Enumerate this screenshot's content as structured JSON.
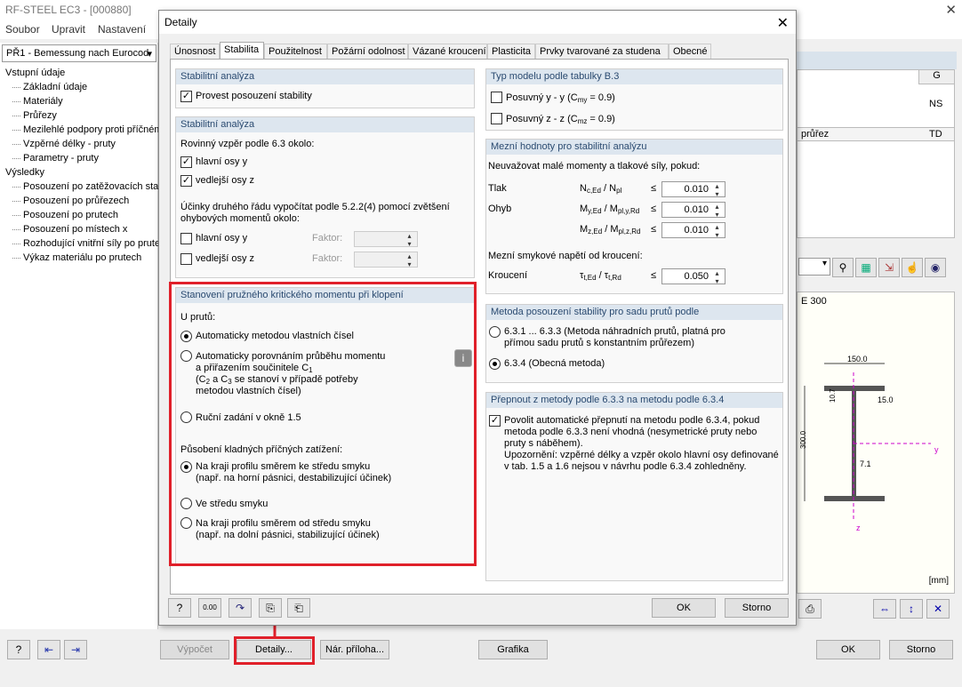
{
  "main_window": {
    "title": "RF-STEEL EC3 - [000880]",
    "menu": [
      "Soubor",
      "Upravit",
      "Nastavení"
    ]
  },
  "left_panel": {
    "case_select": "PŘ1 - Bemessung nach Eurocod",
    "tree": [
      {
        "label": "Vstupní údaje",
        "level": 0
      },
      {
        "label": "Základní údaje",
        "level": 1
      },
      {
        "label": "Materiály",
        "level": 1
      },
      {
        "label": "Průřezy",
        "level": 1
      },
      {
        "label": "Mezilehlé podpory proti příčném",
        "level": 1
      },
      {
        "label": "Vzpěrné délky - pruty",
        "level": 1
      },
      {
        "label": "Parametry - pruty",
        "level": 1
      },
      {
        "label": "Výsledky",
        "level": 0
      },
      {
        "label": "Posouzení po zatěžovacích stav",
        "level": 1
      },
      {
        "label": "Posouzení po průřezech",
        "level": 1
      },
      {
        "label": "Posouzení po prutech",
        "level": 1
      },
      {
        "label": "Posouzení po místech x",
        "level": 1
      },
      {
        "label": "Rozhodující vnitřní síly po prute",
        "level": 1
      },
      {
        "label": "Výkaz materiálu po prutech",
        "level": 1
      }
    ]
  },
  "bottom_bar": {
    "calc": "Výpočet",
    "details": "Detaily...",
    "annex": "Nár. příloha...",
    "graphics": "Grafika",
    "ok": "OK",
    "cancel": "Storno"
  },
  "right_panel": {
    "col_g": "G",
    "ns": "NS",
    "prurez": "průřez",
    "td": "TD",
    "section_label": "E 300",
    "dims": {
      "flange_w": "150.0",
      "flange_t": "10.7",
      "web_label": "15.0",
      "height": "300.0",
      "web_t": "7.1",
      "y": "y",
      "z": "z"
    },
    "unit": "[mm]"
  },
  "dialog": {
    "title": "Detaily",
    "tabs": [
      "Únosnost",
      "Stabilita",
      "Použitelnost",
      "Požární odolnost",
      "Vázané kroucení",
      "Plasticita",
      "Prvky tvarované za studena",
      "Obecné"
    ],
    "active_tab": "Stabilita",
    "g1": {
      "head": "Stabilitní analýza",
      "check": "Provest posouzení stability"
    },
    "g2": {
      "head": "Stabilitní analýza",
      "planar": "Rovinný vzpěr podle 6.3 okolo:",
      "main_axis": "hlavní osy y",
      "minor_axis": "vedlejší osy z",
      "second_order": "Účinky druhého řádu vypočítat podle 5.2.2(4) pomocí zvětšení",
      "second_order2": "ohybových momentů okolo:",
      "main_axis2": "hlavní osy y",
      "minor_axis2": "vedlejší osy z",
      "factor": "Faktor:"
    },
    "g3": {
      "head": "Stanovení pružného kritického momentu při klopení",
      "members": "U prutů:",
      "opt1": "Automaticky metodou vlastních čísel",
      "opt2a": "Automaticky porovnáním průběhu momentu",
      "opt2b": "a přiřazením součinitele C",
      "opt2c": "(C",
      "opt2c2": " a C",
      "opt2c3": " se stanoví v případě potřeby",
      "opt2d": "metodou vlastních čísel)",
      "opt3": "Ruční zadání v okně 1.5",
      "loads": "Působení kladných příčných zatížení:",
      "load1a": "Na kraji profilu směrem ke středu smyku",
      "load1b": "(např. na horní pásnici, destabilizující účinek)",
      "load2": "Ve středu smyku",
      "load3a": "Na kraji profilu směrem od středu smyku",
      "load3b": "(např. na dolní pásnici, stabilizující účinek)",
      "sub1": "1",
      "sub2": "2",
      "sub3": "3"
    },
    "g4": {
      "head": "Typ modelu podle tabulky B.3",
      "yy": "Posuvný y - y (C",
      "yy_sub": "my",
      "yy_end": " = 0.9)",
      "zz": "Posuvný z - z (C",
      "zz_sub": "mz",
      "zz_end": " = 0.9)"
    },
    "g5": {
      "head": "Mezní hodnoty pro stabilitní analýzu",
      "neglect": "Neuvažovat malé momenty a tlakové síly, pokud:",
      "tlak": "Tlak",
      "ohyb": "Ohyb",
      "ratio_n": "N",
      "ratio_n_sub": "c,Ed",
      "ratio_n2": " / N",
      "ratio_n2_sub": "pl",
      "ratio_my": "M",
      "ratio_my_sub": "y,Ed",
      "ratio_my2": " / M",
      "ratio_my2_sub": "pl,y,Rd",
      "ratio_mz": "M",
      "ratio_mz_sub": "z,Ed",
      "ratio_mz2": " / M",
      "ratio_mz2_sub": "pl,z,Rd",
      "le": "≤",
      "v_n": "0.010",
      "v_my": "0.010",
      "v_mz": "0.010",
      "shear": "Mezní smykové napětí od kroucení:",
      "kroucen": "Kroucení",
      "tau": "τ",
      "tau_sub": "t,Ed",
      "tau2": " / τ",
      "tau2_sub": "t,Rd",
      "v_tau": "0.050"
    },
    "g6": {
      "head": "Metoda posouzení stability pro sadu prutů podle",
      "m1a": "6.3.1 ... 6.3.3 (Metoda náhradních prutů, platná pro",
      "m1b": "přímou sadu prutů s konstantním průřezem)",
      "m2": "6.3.4 (Obecná metoda)"
    },
    "g7": {
      "head": "Přepnout z metody podle 6.3.3 na metodu podle 6.3.4",
      "a1": "Povolit automatické přepnutí na metodu podle 6.3.4, pokud",
      "a2": "metoda podle 6.3.3 není vhodná (nesymetrické pruty nebo",
      "a3": "pruty s náběhem).",
      "a4": "Upozornění: vzpěrné délky a vzpěr okolo hlavní osy definované",
      "a5": "v tab. 1.5 a 1.6 nejsou v návrhu podle 6.3.4 zohledněny."
    },
    "ok": "OK",
    "cancel": "Storno"
  },
  "colors": {
    "highlight": "#e0202a",
    "group_head": "#dde6ef"
  }
}
